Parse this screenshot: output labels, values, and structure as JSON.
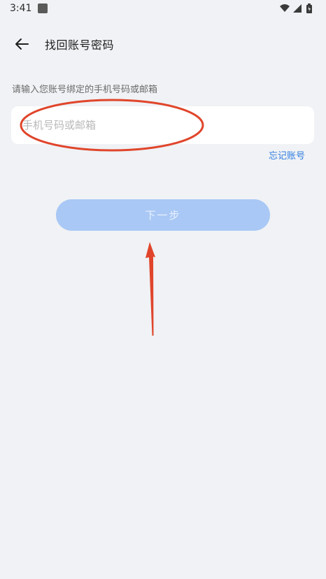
{
  "status_bar": {
    "time": "3:41",
    "icons": [
      "app-notification-icon",
      "wifi-icon",
      "cell-signal-icon",
      "battery-icon"
    ]
  },
  "header": {
    "back_icon": "arrow-left-icon",
    "title": "找回账号密码"
  },
  "form": {
    "instruction": "请输入您账号绑定的手机号码或邮箱",
    "account_input": {
      "value": "",
      "placeholder": "手机号码或邮箱"
    },
    "forgot_account_link": "忘记账号",
    "next_button_label": "下一步"
  },
  "annotations": {
    "highlight_ellipse_color": "#e0452b",
    "arrow_color": "#e0452b"
  },
  "colors": {
    "background": "#f0f2f5",
    "card": "#ffffff",
    "link": "#2f7de0",
    "button_disabled": "#a9c8f5"
  }
}
